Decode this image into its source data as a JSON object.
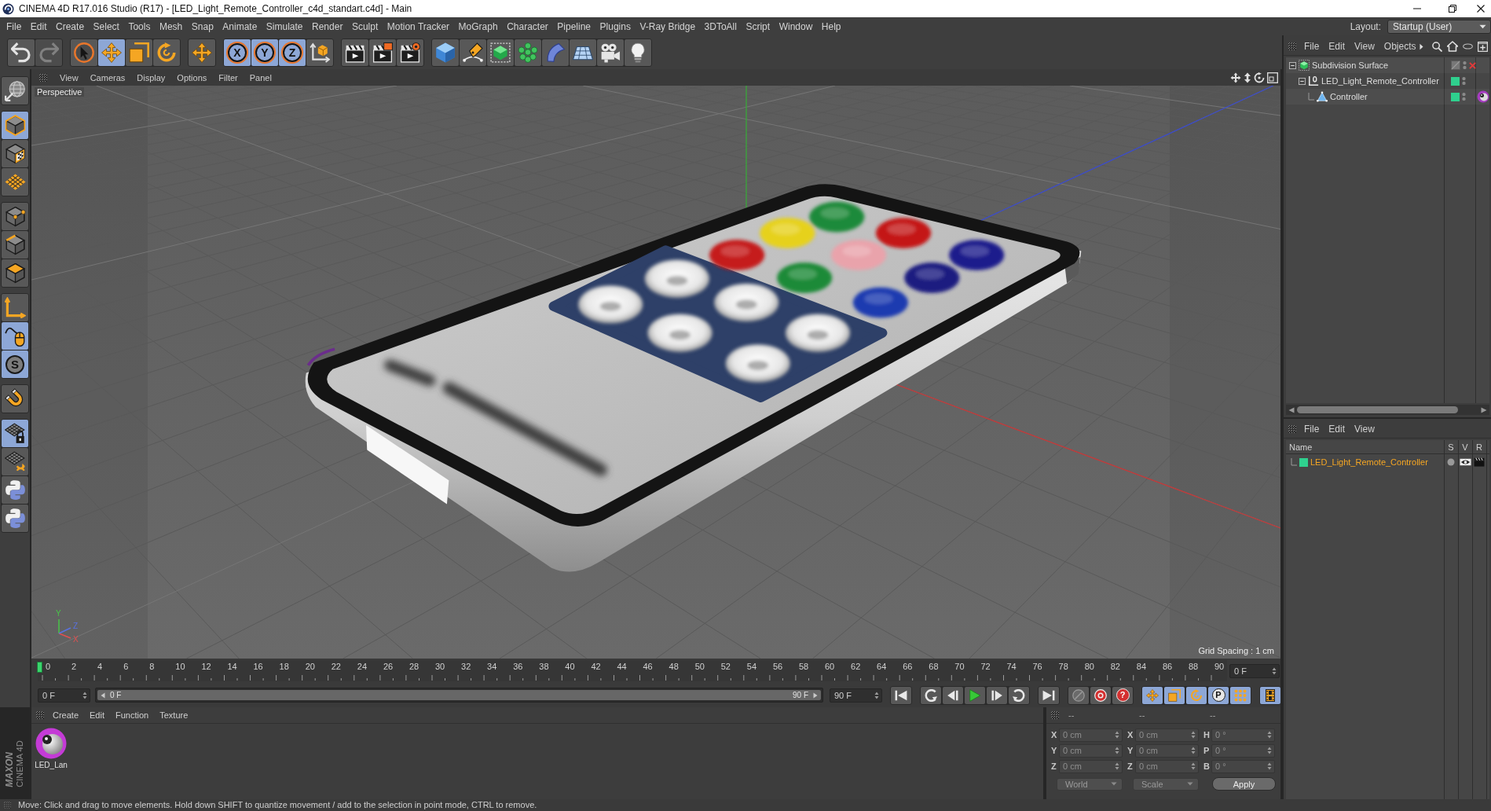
{
  "window": {
    "title": "CINEMA 4D R17.016 Studio (R17) - [LED_Light_Remote_Controller_c4d_standart.c4d] - Main"
  },
  "menu_bar": {
    "items": [
      "File",
      "Edit",
      "Create",
      "Select",
      "Tools",
      "Mesh",
      "Snap",
      "Animate",
      "Simulate",
      "Render",
      "Sculpt",
      "Motion Tracker",
      "MoGraph",
      "Character",
      "Pipeline",
      "Plugins",
      "V-Ray Bridge",
      "3DToAll",
      "Script",
      "Window",
      "Help"
    ],
    "layout_label": "Layout:",
    "layout": "Startup (User)"
  },
  "toolbar": [
    {
      "buttons": [
        {
          "on": false,
          "disabled": false
        },
        {
          "on": false,
          "disabled": true
        }
      ]
    },
    {
      "buttons": [
        {
          "on": false
        },
        {
          "on": true
        },
        {
          "on": false
        },
        {
          "on": false
        }
      ]
    },
    {
      "buttons": [
        {
          "on": false
        }
      ]
    },
    {
      "buttons": [
        {
          "label": "X",
          "on": true
        },
        {
          "label": "Y",
          "on": true
        },
        {
          "label": "Z",
          "on": true
        },
        {
          "on": false
        }
      ]
    },
    {
      "buttons": [
        {
          "on": false
        },
        {
          "on": false
        },
        {
          "on": false
        }
      ]
    },
    {
      "buttons": [
        {
          "on": false
        },
        {
          "on": false
        },
        {
          "on": false
        },
        {
          "on": false
        },
        {
          "on": false
        },
        {
          "on": false
        },
        {
          "on": false
        },
        {
          "on": false
        }
      ]
    }
  ],
  "left_toolbar": [
    {
      "buttons": [
        {
          "on": false
        }
      ]
    },
    {
      "buttons": [
        {
          "on": true
        },
        {
          "on": false
        },
        {
          "on": false
        }
      ]
    },
    {
      "buttons": [
        {
          "on": false
        },
        {
          "on": false
        },
        {
          "on": false
        }
      ]
    },
    {
      "buttons": [
        {
          "on": false
        },
        {
          "on": true
        },
        {
          "label": "S",
          "on": true
        }
      ]
    },
    {
      "buttons": [
        {
          "on": false
        }
      ]
    },
    {
      "buttons": [
        {
          "on": true
        },
        {
          "on": false
        },
        {
          "on": false
        },
        {
          "on": false
        }
      ]
    }
  ],
  "viewport": {
    "menu": [
      "View",
      "Cameras",
      "Display",
      "Options",
      "Filter",
      "Panel"
    ],
    "camera": "Perspective",
    "grid_spacing": "Grid Spacing : 1 cm",
    "axis_labels": [
      "Y",
      "Z",
      "X"
    ]
  },
  "timeline": {
    "frames": [
      "0",
      "2",
      "4",
      "6",
      "8",
      "10",
      "12",
      "14",
      "16",
      "18",
      "20",
      "22",
      "24",
      "26",
      "28",
      "30",
      "32",
      "34",
      "36",
      "38",
      "40",
      "42",
      "44",
      "46",
      "48",
      "50",
      "52",
      "54",
      "56",
      "58",
      "60",
      "62",
      "64",
      "66",
      "68",
      "70",
      "72",
      "74",
      "76",
      "78",
      "80",
      "82",
      "84",
      "86",
      "88",
      "90"
    ],
    "playhead": {
      "level": 0
    },
    "current_frame": "0 F"
  },
  "transport": {
    "start": "0 F",
    "range": {
      "start": "0 F",
      "end": "90 F",
      "level": 1
    },
    "end": "90 F",
    "groups": [
      {
        "buttons": [
          {
            "on": false
          }
        ]
      },
      {
        "buttons": [
          {
            "on": false
          },
          {
            "on": false
          },
          {
            "on": false
          },
          {
            "on": false
          },
          {
            "on": false
          }
        ]
      },
      {
        "buttons": [
          {
            "on": false
          }
        ]
      },
      {
        "buttons": [
          {
            "on": false
          },
          {
            "on": false
          },
          {
            "label": "?",
            "on": false
          }
        ]
      },
      {
        "buttons": [
          {
            "on": true
          },
          {
            "on": true
          },
          {
            "on": true
          },
          {
            "label": "P",
            "on": true
          },
          {
            "on": true
          }
        ]
      },
      {
        "buttons": [
          {
            "on": true
          }
        ]
      }
    ]
  },
  "materials": {
    "menu": [
      "Create",
      "Edit",
      "Function",
      "Texture"
    ],
    "items": [
      {
        "name": "LED_Lan"
      }
    ]
  },
  "coordinates": {
    "headers": [
      "--",
      "--",
      "--"
    ],
    "rows": [
      {
        "position_axis": "X",
        "position": "0 cm",
        "size_axis": "X",
        "size": "0 cm",
        "rotation_axis": "H",
        "rotation": "0 °"
      },
      {
        "position_axis": "Y",
        "position": "0 cm",
        "size_axis": "Y",
        "size": "0 cm",
        "rotation_axis": "P",
        "rotation": "0 °"
      },
      {
        "position_axis": "Z",
        "position": "0 cm",
        "size_axis": "Z",
        "size": "0 cm",
        "rotation_axis": "B",
        "rotation": "0 °"
      }
    ],
    "mode": "World",
    "size_mode": "Scale",
    "apply": "Apply"
  },
  "object_manager": {
    "menu": [
      "File",
      "Edit",
      "View",
      "Objects"
    ],
    "tree": [
      {
        "name": "Subdivision Surface",
        "kind": "subdivision",
        "selected": false,
        "expanded": true,
        "enabled": false,
        "children": [
          {
            "name": "LED_Light_Remote_Controller",
            "kind": "null",
            "selected": false,
            "expanded": true,
            "color": "#2fd08e",
            "children": [
              {
                "name": "Controller",
                "kind": "polygon",
                "selected": false,
                "color": "#2fd08e",
                "tags": [
                  {
                    "kind": "material"
                  }
                ]
              }
            ]
          }
        ]
      }
    ]
  },
  "layer_manager": {
    "menu": [
      "File",
      "Edit",
      "View"
    ],
    "columns": [
      "Name",
      "S",
      "V",
      "R"
    ],
    "rows": [
      {
        "name": "LED_Light_Remote_Controller",
        "color": "#2fd08e",
        "selected": true,
        "solo": false,
        "visible": true,
        "render": true
      }
    ]
  },
  "status_bar": {
    "message": "Move: Click and drag to move elements. Hold down SHIFT to quantize movement / add to the selection in point mode, CTRL to remove."
  },
  "logo": {
    "brand": "MAXON",
    "product": "CINEMA 4D"
  }
}
